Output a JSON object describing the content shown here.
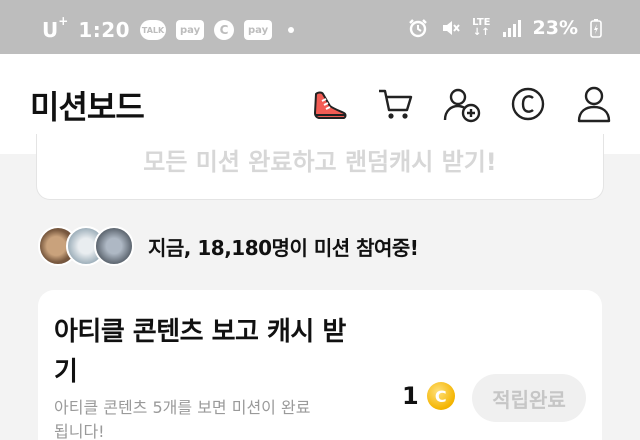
{
  "statusbar": {
    "carrier": "U",
    "carrier_sup": "+",
    "time": "1:20",
    "badges": [
      "TALK",
      "pay",
      "C",
      "pay"
    ],
    "lte": "LTE",
    "battery": "23%"
  },
  "header": {
    "title": "미션보드",
    "icons": [
      "sneaker-icon",
      "cart-icon",
      "add-friend-icon",
      "cash-coin-icon",
      "profile-icon"
    ]
  },
  "banner": {
    "text": "모든 미션 완료하고 랜덤캐시 받기!"
  },
  "participants": {
    "prefix": "지금, ",
    "count": "18,180명",
    "suffix": "이 미션 참여중!"
  },
  "mission": {
    "title": "아티클 콘텐츠 보고 캐시 받기",
    "description": "아티클 콘텐츠 5개를 보면 미션이 완료됩니다!",
    "reward": "1",
    "coin_symbol": "C",
    "status_button": "적립완료"
  },
  "colors": {
    "statusbar_bg": "#bdbdbd",
    "accent_red": "#f25c54",
    "coin": "#f4b400"
  }
}
